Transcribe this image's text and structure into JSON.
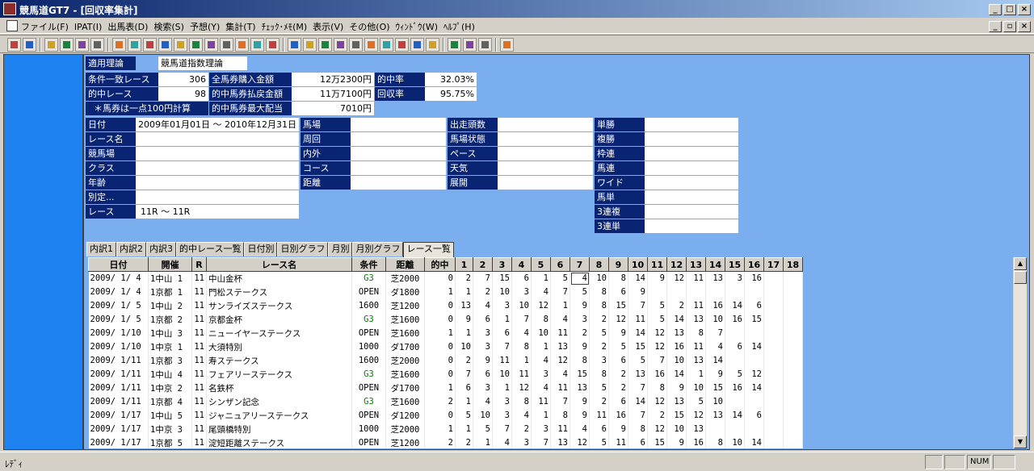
{
  "window": {
    "title": "競馬道GT7 - [回収率集計]"
  },
  "menu": [
    "ファイル(F)",
    "IPAT(I)",
    "出馬表(D)",
    "検索(S)",
    "予想(Y)",
    "集計(T)",
    "ﾁｪｯｸ･ﾒﾓ(M)",
    "表示(V)",
    "その他(O)",
    "ｳｨﾝﾄﾞｳ(W)",
    "ﾍﾙﾌﾟ(H)"
  ],
  "summary": {
    "theory_label": "適用理論",
    "theory_value": "競馬道指数理論",
    "match_races_label": "条件一致レース",
    "match_races_value": "306",
    "hit_races_label": "的中レース",
    "hit_races_value": "98",
    "note": "＊馬券は一点100円計算",
    "total_purchase_label": "全馬券購入金額",
    "total_purchase_value": "12万2300円",
    "total_payout_label": "的中馬券払戻金額",
    "total_payout_value": "11万7100円",
    "max_payout_label": "的中馬券最大配当",
    "max_payout_value": "7010円",
    "hit_rate_label": "的中率",
    "hit_rate_value": "32.03%",
    "return_rate_label": "回収率",
    "return_rate_value": "95.75%"
  },
  "conditions": {
    "date_label": "日付",
    "date_value": "2009年01月01日 ～ 2010年12月31日",
    "race_name_label": "レース名",
    "race_name_value": "",
    "course_label": "競馬場",
    "course_value": "",
    "class_label": "クラス",
    "class_value": "",
    "age_label": "年齢",
    "age_value": "",
    "special_label": "別定...",
    "special_value": "",
    "race_label": "レース",
    "race_value": "11R ～ 11R",
    "track_label": "馬場",
    "track_value": "",
    "lap_label": "周回",
    "lap_value": "",
    "inout_label": "内外",
    "inout_value": "",
    "course2_label": "コース",
    "course2_value": "",
    "distance_label": "距離",
    "distance_value": "",
    "runners_label": "出走頭数",
    "runners_value": "",
    "ground_label": "馬場状態",
    "ground_value": "",
    "pace_label": "ペース",
    "pace_value": "",
    "weather_label": "天気",
    "weather_value": "",
    "development_label": "展開",
    "development_value": "",
    "bet_types": [
      "単勝",
      "複勝",
      "枠連",
      "馬連",
      "ワイド",
      "馬単",
      "3連複",
      "3連単"
    ]
  },
  "tabs": [
    "内訳1",
    "内訳2",
    "内訳3",
    "的中レース一覧",
    "日付別",
    "日別グラフ",
    "月別",
    "月別グラフ",
    "レース一覧"
  ],
  "active_tab": 8,
  "table": {
    "headers": [
      "日付",
      "開催",
      "R",
      "レース名",
      "条件",
      "距離",
      "的中",
      "1",
      "2",
      "3",
      "4",
      "5",
      "6",
      "7",
      "8",
      "9",
      "10",
      "11",
      "12",
      "13",
      "14",
      "15",
      "16",
      "17",
      "18"
    ],
    "rows": [
      [
        "2009/ 1/ 4",
        "1中山 1",
        "11",
        "中山金杯",
        "G3",
        "芝2000",
        "0",
        "2",
        "7",
        "15",
        "6",
        "1",
        "5",
        "4",
        "10",
        "8",
        "14",
        "9",
        "12",
        "11",
        "13",
        "3",
        "16",
        "",
        ""
      ],
      [
        "2009/ 1/ 4",
        "1京都 1",
        "11",
        "門松ステークス",
        "OPEN",
        "ダ1800",
        "1",
        "1",
        "2",
        "10",
        "3",
        "4",
        "7",
        "5",
        "8",
        "6",
        "9",
        "",
        "",
        "",
        "",
        "",
        "",
        "",
        ""
      ],
      [
        "2009/ 1/ 5",
        "1中山 2",
        "11",
        "サンライズステークス",
        "1600",
        "芝1200",
        "0",
        "13",
        "4",
        "3",
        "10",
        "12",
        "1",
        "9",
        "8",
        "15",
        "7",
        "5",
        "2",
        "11",
        "16",
        "14",
        "6",
        "",
        ""
      ],
      [
        "2009/ 1/ 5",
        "1京都 2",
        "11",
        "京都金杯",
        "G3",
        "芝1600",
        "0",
        "9",
        "6",
        "1",
        "7",
        "8",
        "4",
        "3",
        "2",
        "12",
        "11",
        "5",
        "14",
        "13",
        "10",
        "16",
        "15",
        "",
        ""
      ],
      [
        "2009/ 1/10",
        "1中山 3",
        "11",
        "ニューイヤーステークス",
        "OPEN",
        "芝1600",
        "1",
        "1",
        "3",
        "6",
        "4",
        "10",
        "11",
        "2",
        "5",
        "9",
        "14",
        "12",
        "13",
        "8",
        "7",
        "",
        "",
        "",
        ""
      ],
      [
        "2009/ 1/10",
        "1中京 1",
        "11",
        "大須特別",
        "1000",
        "ダ1700",
        "0",
        "10",
        "3",
        "7",
        "8",
        "1",
        "13",
        "9",
        "2",
        "5",
        "15",
        "12",
        "16",
        "11",
        "4",
        "6",
        "14",
        "",
        ""
      ],
      [
        "2009/ 1/11",
        "1京都 3",
        "11",
        "寿ステークス",
        "1600",
        "芝2000",
        "0",
        "2",
        "9",
        "11",
        "1",
        "4",
        "12",
        "8",
        "3",
        "6",
        "5",
        "7",
        "10",
        "13",
        "14",
        "",
        "",
        "",
        ""
      ],
      [
        "2009/ 1/11",
        "1中山 4",
        "11",
        "フェアリーステークス",
        "G3",
        "芝1600",
        "0",
        "7",
        "6",
        "10",
        "11",
        "3",
        "4",
        "15",
        "8",
        "2",
        "13",
        "16",
        "14",
        "1",
        "9",
        "5",
        "12",
        "",
        ""
      ],
      [
        "2009/ 1/11",
        "1中京 2",
        "11",
        "名鉄杯",
        "OPEN",
        "ダ1700",
        "1",
        "6",
        "3",
        "1",
        "12",
        "4",
        "11",
        "13",
        "5",
        "2",
        "7",
        "8",
        "9",
        "10",
        "15",
        "16",
        "14",
        "",
        ""
      ],
      [
        "2009/ 1/11",
        "1京都 4",
        "11",
        "シンザン記念",
        "G3",
        "芝1600",
        "2",
        "1",
        "4",
        "3",
        "8",
        "11",
        "7",
        "9",
        "2",
        "6",
        "14",
        "12",
        "13",
        "5",
        "10",
        "",
        "",
        "",
        ""
      ],
      [
        "2009/ 1/17",
        "1中山 5",
        "11",
        "ジャニュアリーステークス",
        "OPEN",
        "ダ1200",
        "0",
        "5",
        "10",
        "3",
        "4",
        "1",
        "8",
        "9",
        "11",
        "16",
        "7",
        "2",
        "15",
        "12",
        "13",
        "14",
        "6",
        "",
        ""
      ],
      [
        "2009/ 1/17",
        "1中京 3",
        "11",
        "尾頭橋特別",
        "1000",
        "芝2000",
        "1",
        "1",
        "5",
        "7",
        "2",
        "3",
        "11",
        "4",
        "6",
        "9",
        "8",
        "12",
        "10",
        "13",
        "",
        "",
        "",
        "",
        ""
      ],
      [
        "2009/ 1/17",
        "1京都 5",
        "11",
        "淀短距離ステークス",
        "OPEN",
        "芝1200",
        "2",
        "2",
        "1",
        "4",
        "3",
        "7",
        "13",
        "12",
        "5",
        "11",
        "6",
        "15",
        "9",
        "16",
        "8",
        "10",
        "14",
        "",
        ""
      ]
    ]
  },
  "status": {
    "text": "ﾚﾃﾞｨ",
    "num": "NUM"
  }
}
